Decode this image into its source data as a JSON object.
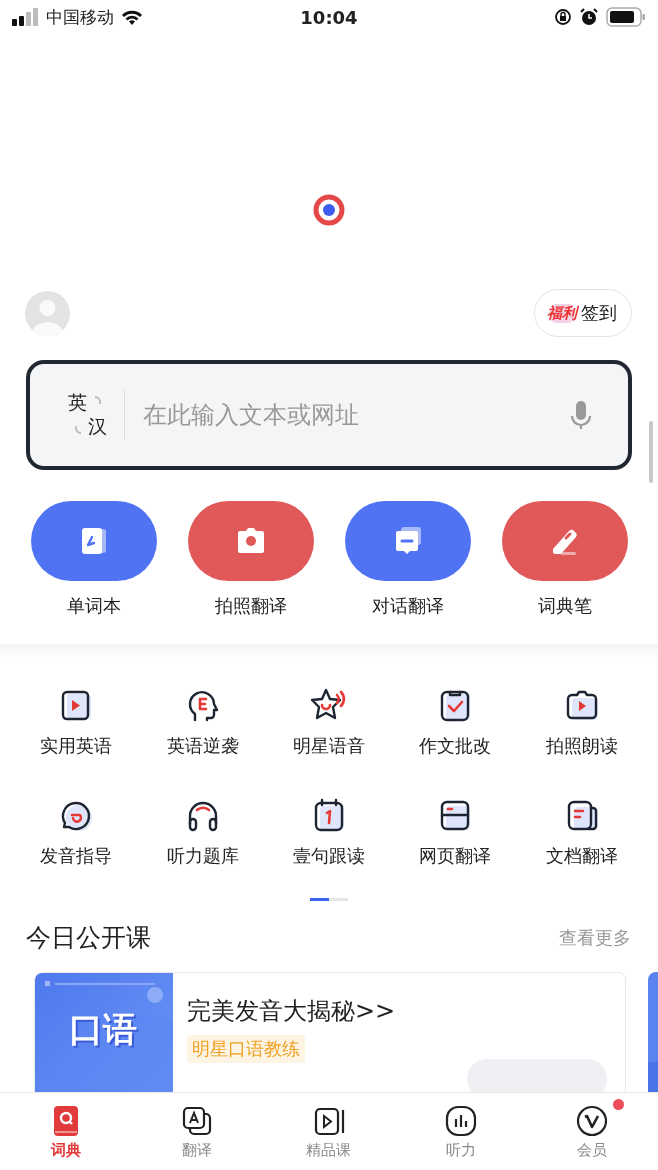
{
  "status_bar": {
    "carrier": "中国移动",
    "time": "10:04"
  },
  "checkin": {
    "badge": "福利",
    "label": "签到"
  },
  "search": {
    "lang_from": "英",
    "lang_to": "汉",
    "placeholder": "在此输入文本或网址"
  },
  "quick_actions": [
    {
      "label": "单词本",
      "kind": "wordbook",
      "color": "#4f73f3"
    },
    {
      "label": "拍照翻译",
      "kind": "camera",
      "color": "#e05858"
    },
    {
      "label": "对话翻译",
      "kind": "chat",
      "color": "#4f73f3"
    },
    {
      "label": "词典笔",
      "kind": "pen",
      "color": "#e05858"
    }
  ],
  "tools": [
    {
      "label": "实用英语",
      "kind": "video"
    },
    {
      "label": "英语逆袭",
      "kind": "head"
    },
    {
      "label": "明星语音",
      "kind": "star"
    },
    {
      "label": "作文批改",
      "kind": "clipboard"
    },
    {
      "label": "拍照朗读",
      "kind": "camera"
    },
    {
      "label": "发音指导",
      "kind": "bubble"
    },
    {
      "label": "听力题库",
      "kind": "headphones"
    },
    {
      "label": "壹句跟读",
      "kind": "calendar"
    },
    {
      "label": "网页翻译",
      "kind": "web"
    },
    {
      "label": "文档翻译",
      "kind": "doc"
    }
  ],
  "pager": [
    {
      "selected": true
    },
    {
      "selected": false
    }
  ],
  "courses": {
    "title": "今日公开课",
    "more": "查看更多",
    "cards": [
      {
        "thumb_title": "口语",
        "title": "完美发音大揭秘>>",
        "tag": "明星口语教练"
      }
    ]
  },
  "tab_bar": [
    {
      "label": "词典",
      "kind": "dict",
      "selected": true,
      "dot": false
    },
    {
      "label": "翻译",
      "kind": "translate",
      "selected": false,
      "dot": false
    },
    {
      "label": "精品课",
      "kind": "course",
      "selected": false,
      "dot": false
    },
    {
      "label": "听力",
      "kind": "listen",
      "selected": false,
      "dot": false
    },
    {
      "label": "会员",
      "kind": "vip",
      "selected": false,
      "dot": true
    }
  ]
}
